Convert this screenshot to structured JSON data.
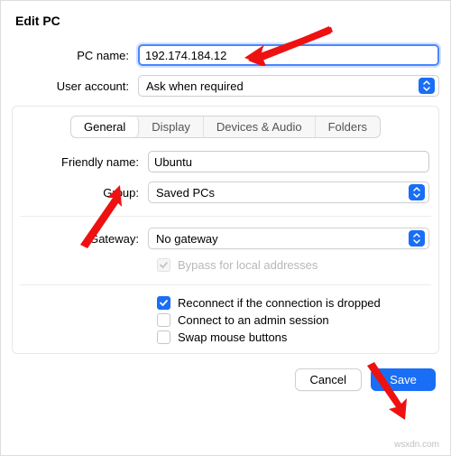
{
  "title": "Edit PC",
  "labels": {
    "pc_name": "PC name:",
    "user_account": "User account:",
    "friendly_name": "Friendly name:",
    "group": "Group:",
    "gateway": "Gateway:"
  },
  "fields": {
    "pc_name_value": "192.174.184.12",
    "user_account_value": "Ask when required",
    "friendly_name_value": "Ubuntu",
    "group_value": "Saved PCs",
    "gateway_value": "No gateway"
  },
  "tabs": {
    "general": "General",
    "display": "Display",
    "devices_audio": "Devices & Audio",
    "folders": "Folders"
  },
  "checks": {
    "bypass": "Bypass for local addresses",
    "reconnect": "Reconnect if the connection is dropped",
    "admin": "Connect to an admin session",
    "swap": "Swap mouse buttons"
  },
  "buttons": {
    "cancel": "Cancel",
    "save": "Save"
  },
  "watermark": "wsxdn.com"
}
